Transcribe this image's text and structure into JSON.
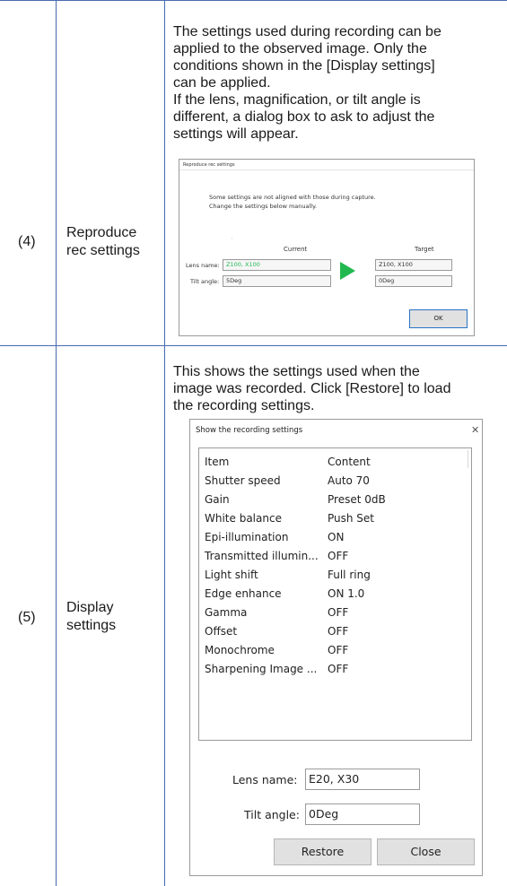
{
  "row4": {
    "number": "(4)",
    "label_lines": [
      "Reproduce",
      "rec settings"
    ],
    "description_lines": [
      "The settings used during recording can be",
      "applied to the observed image. Only the",
      "conditions shown in the [Display settings]",
      "can be applied.",
      "If the lens, magnification, or tilt angle is",
      "different, a dialog box to ask to adjust the",
      "settings will appear."
    ],
    "dialog": {
      "title": "Reproduce rec settings",
      "message_lines": [
        "Some settings are not aligned with those during capture.",
        "Change the settings below manually."
      ],
      "dot": "·",
      "current_header": "Current",
      "target_header": "Target",
      "lens_label": "Lens name:",
      "tilt_label": "Tilt angle:",
      "current_lens": "Z100, X100",
      "current_tilt": "5Deg",
      "target_lens": "Z100, X100",
      "target_tilt": "0Deg",
      "ok_label": "OK",
      "arrow_icon": "play-arrow-icon",
      "arrow_color": "#21b84f",
      "current_lens_color": "#21b84f"
    }
  },
  "row5": {
    "number": "(5)",
    "label_lines": [
      "Display",
      "settings"
    ],
    "description_lines": [
      "This shows the settings used when the",
      "image was recorded. Click [Restore] to load",
      "the recording settings."
    ],
    "dialog": {
      "title": "Show the recording settings",
      "close_glyph": "✕",
      "header": {
        "item": "Item",
        "content": "Content"
      },
      "rows": [
        {
          "item": "Shutter speed",
          "content": "Auto 70"
        },
        {
          "item": "Gain",
          "content": "Preset 0dB"
        },
        {
          "item": "White balance",
          "content": "Push Set"
        },
        {
          "item": "Epi-illumination",
          "content": "ON"
        },
        {
          "item": "Transmitted illumin...",
          "content": "OFF"
        },
        {
          "item": "Light shift",
          "content": "Full ring"
        },
        {
          "item": "Edge enhance",
          "content": "ON 1.0"
        },
        {
          "item": "Gamma",
          "content": "OFF"
        },
        {
          "item": "Offset",
          "content": "OFF"
        },
        {
          "item": "Monochrome",
          "content": "OFF"
        },
        {
          "item": "Sharpening Image ...",
          "content": "OFF"
        }
      ],
      "lens_label": "Lens name:",
      "lens_value": "E20, X30",
      "tilt_label": "Tilt angle:",
      "tilt_value": "0Deg",
      "restore_label": "Restore",
      "close_label": "Close"
    }
  },
  "colors": {
    "table_line": "#4a6bb1"
  }
}
